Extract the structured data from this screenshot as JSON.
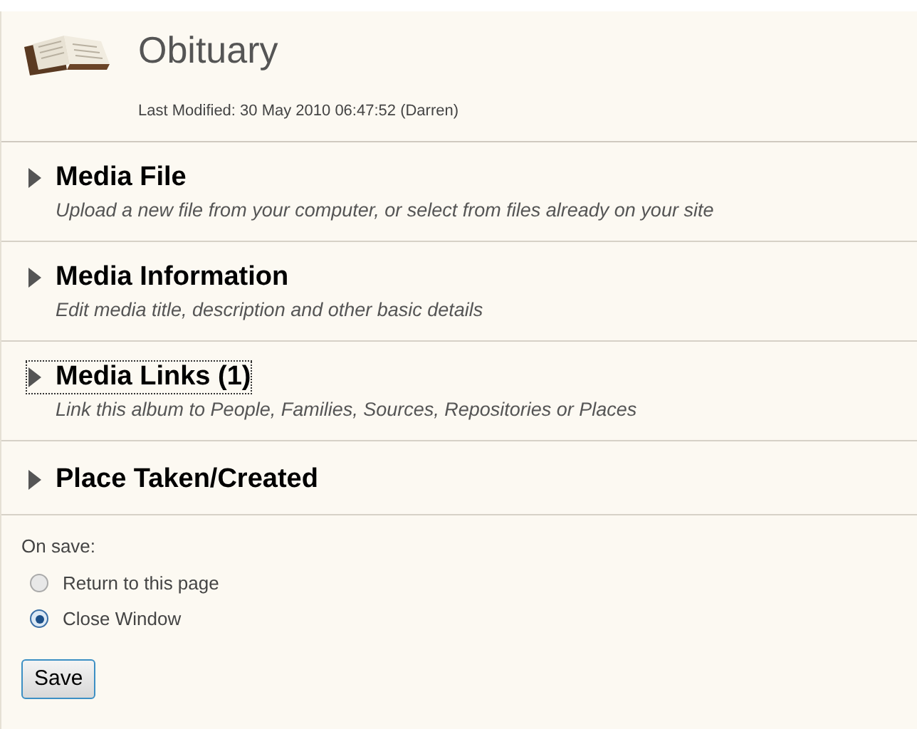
{
  "header": {
    "title": "Obituary",
    "last_modified": "Last Modified: 30 May 2010 06:47:52 (Darren)"
  },
  "sections": [
    {
      "title": "Media File",
      "description": "Upload a new file from your computer, or select from files already on your site",
      "expanded": false,
      "focused": false
    },
    {
      "title": "Media Information",
      "description": "Edit media title, description and other basic details",
      "expanded": false,
      "focused": false
    },
    {
      "title": "Media Links (1)",
      "description": "Link this album to People, Families, Sources, Repositories or Places",
      "expanded": false,
      "focused": true
    },
    {
      "title": "Place Taken/Created",
      "expanded": false,
      "focused": false
    }
  ],
  "on_save": {
    "label": "On save:",
    "options": [
      {
        "label": "Return to this page",
        "selected": false
      },
      {
        "label": "Close Window",
        "selected": true
      }
    ]
  },
  "save_button": "Save"
}
